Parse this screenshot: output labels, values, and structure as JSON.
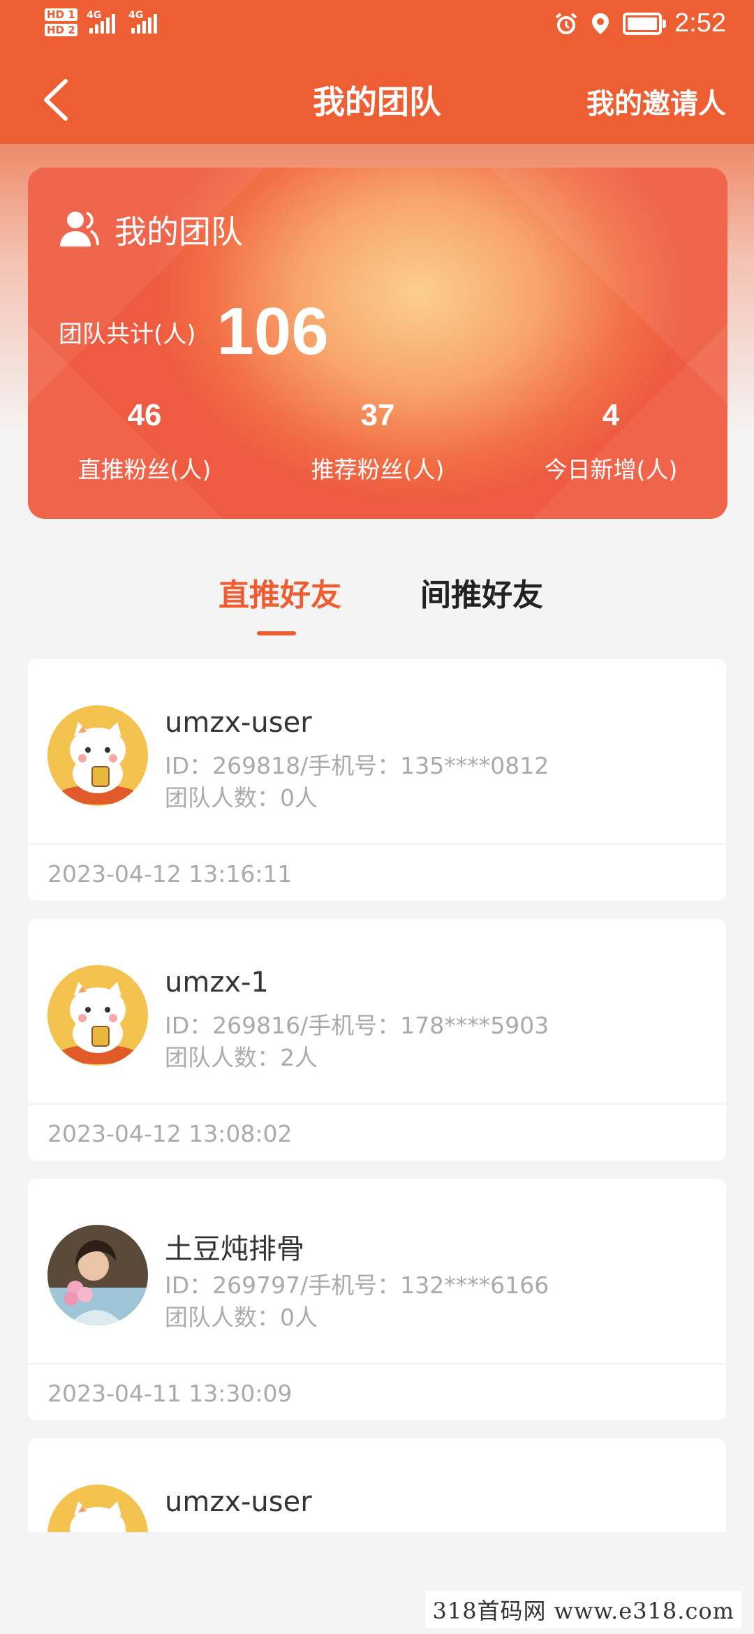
{
  "status": {
    "hd1": "HD 1",
    "hd2": "HD 2",
    "net1": "4G",
    "net2": "4G",
    "time": "2:52"
  },
  "nav": {
    "title": "我的团队",
    "right_label": "我的邀请人"
  },
  "team_card": {
    "title": "我的团队",
    "total_label": "团队共计(人)",
    "total_value": "106",
    "stats": [
      {
        "value": "46",
        "label": "直推粉丝(人)"
      },
      {
        "value": "37",
        "label": "推荐粉丝(人)"
      },
      {
        "value": "4",
        "label": "今日新增(人)"
      }
    ]
  },
  "tabs": [
    {
      "label": "直推好友",
      "active": true
    },
    {
      "label": "间推好友",
      "active": false
    }
  ],
  "members": [
    {
      "name": "umzx-user",
      "info": "ID：269818/手机号：135****0812",
      "team": "团队人数：0人",
      "time": "2023-04-12 13:16:11",
      "avatar": "cat-avatar"
    },
    {
      "name": "umzx-1",
      "info": "ID：269816/手机号：178****5903",
      "team": "团队人数：2人",
      "time": "2023-04-12 13:08:02",
      "avatar": "cat-avatar"
    },
    {
      "name": "土豆炖排骨",
      "info": "ID：269797/手机号：132****6166",
      "team": "团队人数：0人",
      "time": "2023-04-11 13:30:09",
      "avatar": "photo-avatar"
    },
    {
      "name": "umzx-user",
      "info": "",
      "team": "",
      "time": "",
      "avatar": "cat-avatar"
    }
  ],
  "watermark": "318首码网  www.e318.com",
  "colors": {
    "accent": "#ee5e33",
    "muted": "#aaaaaa",
    "bg": "#f4f4f4"
  }
}
